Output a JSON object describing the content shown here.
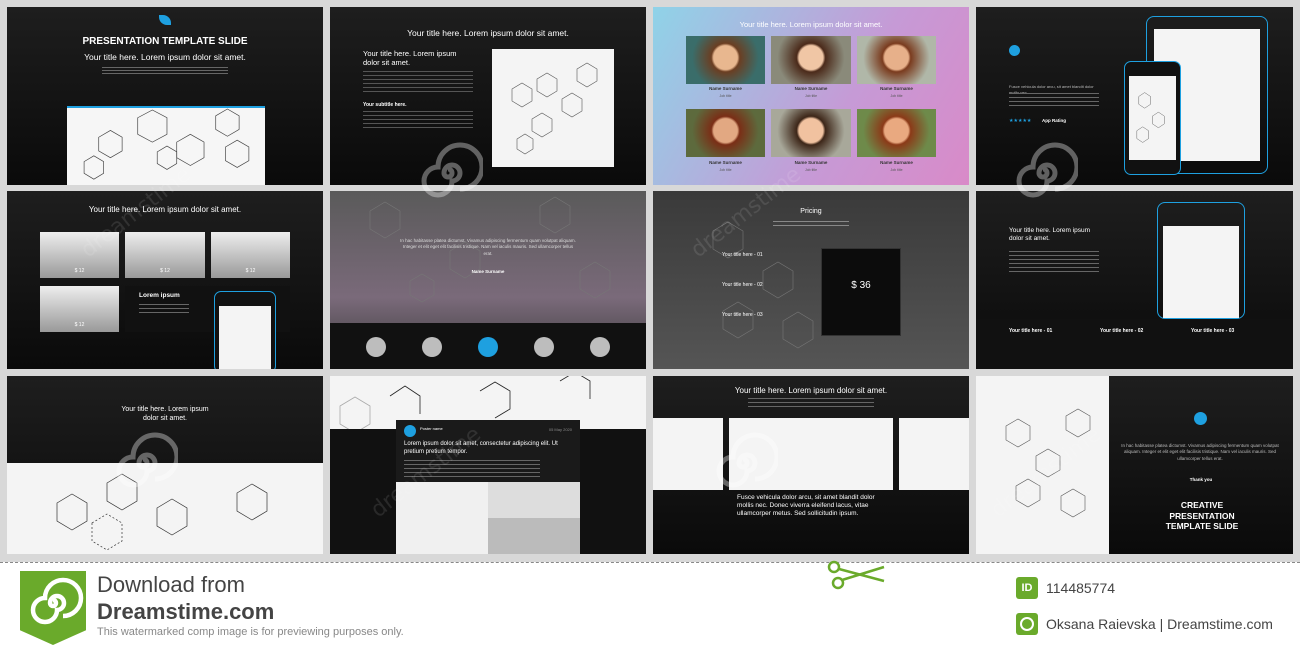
{
  "slides": {
    "s1": {
      "title": "PRESENTATION TEMPLATE SLIDE",
      "subtitle": "Your title here. Lorem ipsum dolor sit amet."
    },
    "s2": {
      "title": "Your title here. Lorem ipsum dolor sit amet.",
      "heading": "Your title here. Lorem ipsum dolor sit amet.",
      "subheading": "Your subtitle here."
    },
    "s3": {
      "title": "Your title here. Lorem ipsum dolor sit amet.",
      "people": [
        {
          "name": "Name Surname",
          "job": "Job title"
        },
        {
          "name": "Name Surname",
          "job": "Job title"
        },
        {
          "name": "Name Surname",
          "job": "Job title"
        },
        {
          "name": "Name Surname",
          "job": "Job title"
        },
        {
          "name": "Name Surname",
          "job": "Job title"
        },
        {
          "name": "Name Surname",
          "job": "Job title"
        }
      ]
    },
    "s4": {
      "rating": "App Rating",
      "text": "Fusce vehicula dolor arcu, sit amet blandit dolor mollis nec."
    },
    "s5": {
      "title": "Your title here. Lorem ipsum dolor sit amet.",
      "heading": "Lorem ipsum",
      "price": "$ 12"
    },
    "s6": {
      "quote": "In hac habitasse platea dictumst. Vivamus adipiscing fermentum quam volutpat aliquam. Integer et elit eget elit facilisis tristique. Nam vel iaculis mauris. Sed ullamcorper tellus erat.",
      "name": "Name Surname"
    },
    "s7": {
      "title": "Pricing",
      "items": [
        "Your title here - 01",
        "Your title here - 02",
        "Your title here - 03"
      ],
      "price": "$ 36"
    },
    "s8": {
      "title": "Your title here. Lorem ipsum dolor sit amet.",
      "cols": [
        "Your title here - 01",
        "Your title here - 02",
        "Your title here - 03"
      ]
    },
    "s9": {
      "title": "Your title here. Lorem ipsum dolor sit amet."
    },
    "s10": {
      "poster": "Poster name",
      "date": "05 May 2020",
      "heading": "Lorem ipsum dolor sit amet, consectetur adipiscing elit. Ut pretium pretium tempor."
    },
    "s11": {
      "title": "Your title here. Lorem ipsum dolor sit amet.",
      "body": "Fusce vehicula dolor arcu, sit amet blandit dolor mollis nec. Donec viverra eleifend lacus, vitae ullamcorper metus. Sed sollicitudin ipsum."
    },
    "s12": {
      "quote": "In hac habitasse platea dictumst. Vivamus adipiscing fermentum quam volutpat aliquam. Integer et elit eget elit facilisis tristique. Nam vel iaculis mauris. Sed ullamcorper tellus erat.",
      "thanks": "Thank you",
      "title": "CREATIVE PRESENTATION TEMPLATE SLIDE"
    }
  },
  "watermark": "dreamstime",
  "footer": {
    "download_line": "Download from",
    "brand": "Dreamstime.com",
    "disclaimer": "This watermarked comp image is for previewing purposes only.",
    "id_badge": "ID",
    "image_id": "114485774",
    "author": "Oksana Raievska | Dreamstime.com"
  },
  "colors": {
    "accent": "#1ea0e0",
    "brand_green": "#6aaa2b",
    "slide_dark": "#141414"
  }
}
